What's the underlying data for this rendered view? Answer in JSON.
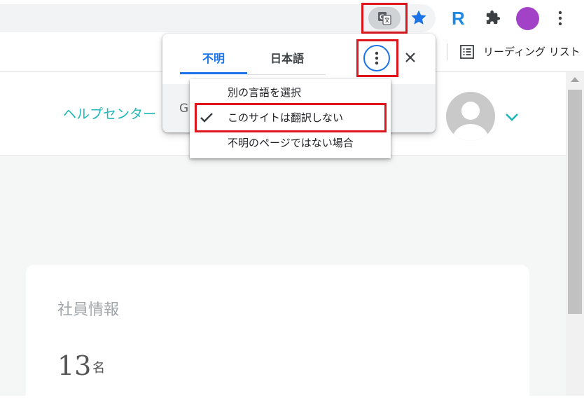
{
  "browser": {
    "toolbar_icons": [
      "translate-icon",
      "star-icon",
      "extension-r-icon",
      "puzzle-icon",
      "profile-avatar",
      "more-vertical-icon"
    ],
    "bookmarks_bar": {
      "reading_list_label": "リーディング リスト"
    },
    "colors": {
      "accent": "#1a73e8",
      "profile": "#a142c7",
      "highlight_box": "#e0151b"
    }
  },
  "translate_popup": {
    "tabs": [
      {
        "label": "不明",
        "selected": true
      },
      {
        "label": "日本語",
        "selected": false
      }
    ],
    "menu": {
      "items": [
        {
          "label": "別の言語を選択",
          "checked": false
        },
        {
          "label": "このサイトは翻訳しない",
          "checked": true
        },
        {
          "label": "不明のページではない場合",
          "checked": false
        }
      ]
    },
    "footer_letter": "G"
  },
  "page": {
    "help_link": "ヘルプセンター",
    "card": {
      "title": "社員情報",
      "count": "13",
      "unit": "名"
    },
    "colors": {
      "help_link": "#20b7b7"
    }
  }
}
